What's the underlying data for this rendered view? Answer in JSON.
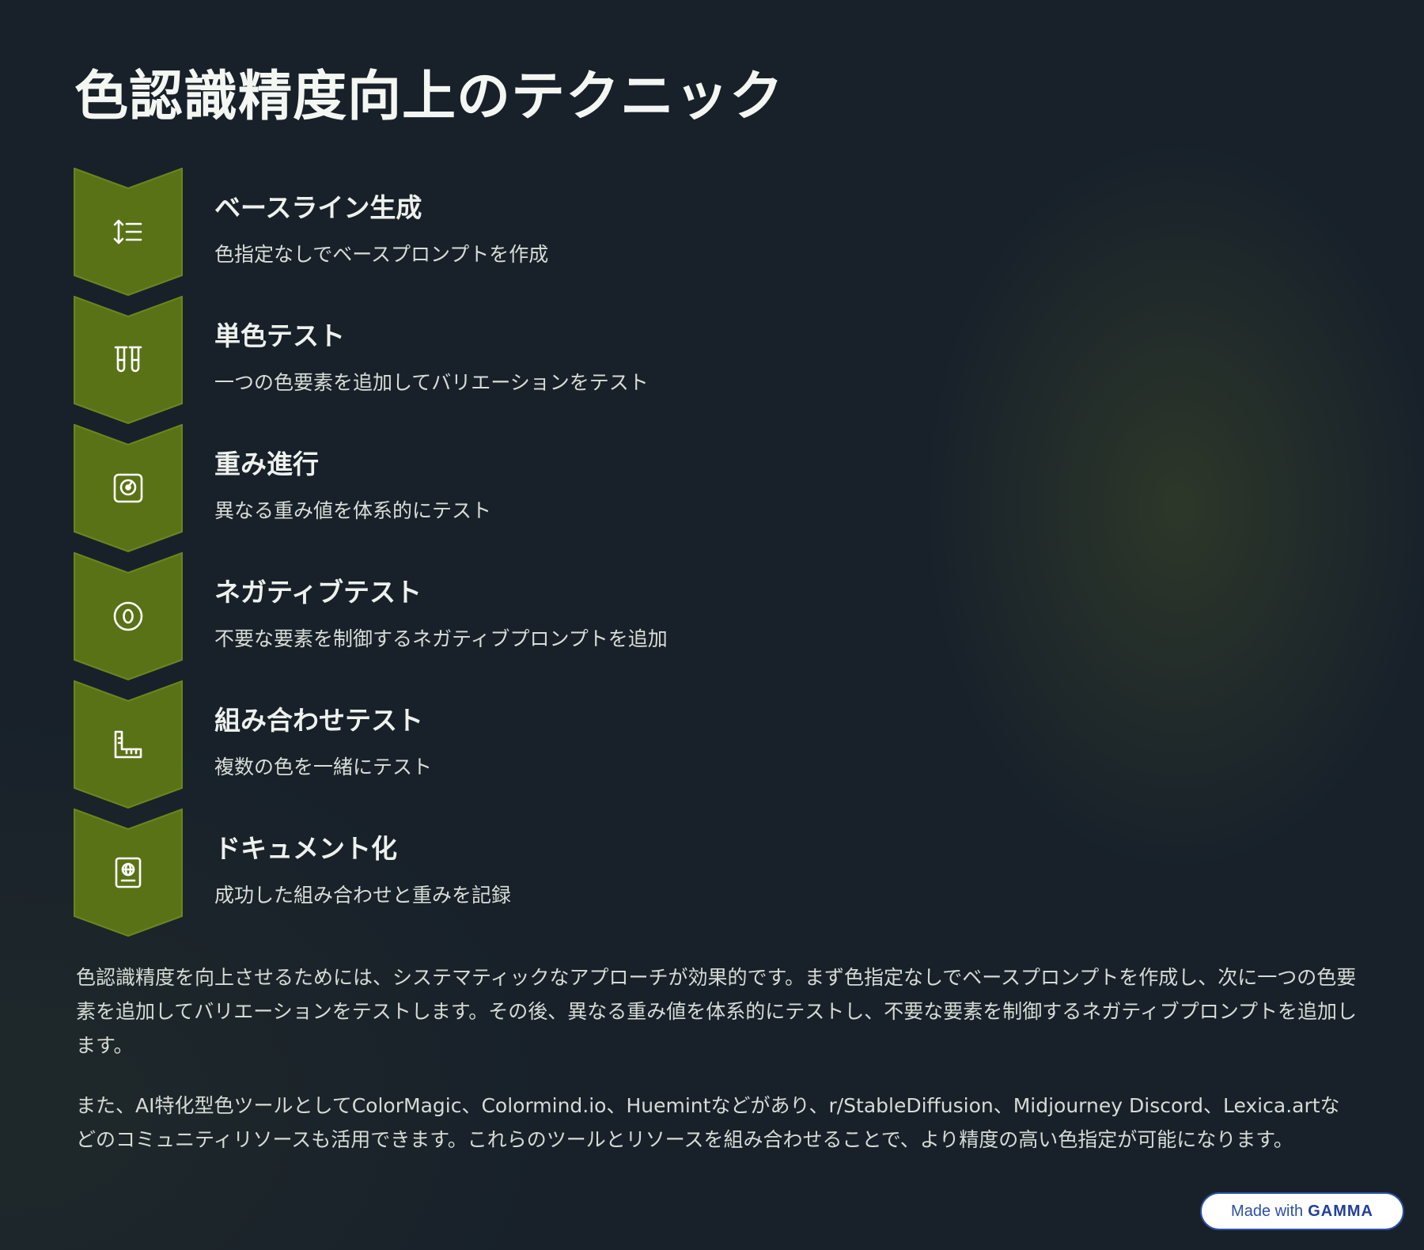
{
  "page": {
    "title": "色認識精度向上のテクニック"
  },
  "colors": {
    "background": "#18212a",
    "chevron_fill": "#5a7216",
    "chevron_stroke": "#6a8520",
    "text_primary": "#eef1ec",
    "badge_border": "#2d4fa6"
  },
  "steps": [
    {
      "icon": "sort-list-icon",
      "title": "ベースライン生成",
      "description": "色指定なしでベースプロンプトを作成"
    },
    {
      "icon": "test-tubes-icon",
      "title": "単色テスト",
      "description": "一つの色要素を追加してバリエーションをテスト"
    },
    {
      "icon": "scale-icon",
      "title": "重み進行",
      "description": "異なる重み値を体系的にテスト"
    },
    {
      "icon": "circle-zero-icon",
      "title": "ネガティブテスト",
      "description": "不要な要素を制御するネガティブプロンプトを追加"
    },
    {
      "icon": "ruler-icon",
      "title": "組み合わせテスト",
      "description": "複数の色を一緒にテスト"
    },
    {
      "icon": "passport-icon",
      "title": "ドキュメント化",
      "description": "成功した組み合わせと重みを記録"
    }
  ],
  "paragraphs": [
    "色認識精度を向上させるためには、システマティックなアプローチが効果的です。まず色指定なしでベースプロンプトを作成し、次に一つの色要素を追加してバリエーションをテストします。その後、異なる重み値を体系的にテストし、不要な要素を制御するネガティブプロンプトを追加します。",
    "また、AI特化型色ツールとしてColorMagic、Colormind.io、Huemintなどがあり、r/StableDiffusion、Midjourney Discord、Lexica.artなどのコミュニティリソースも活用できます。これらのツールとリソースを組み合わせることで、より精度の高い色指定が可能になります。"
  ],
  "badge": {
    "prefix": "Made with",
    "brand": "GAMMA"
  }
}
